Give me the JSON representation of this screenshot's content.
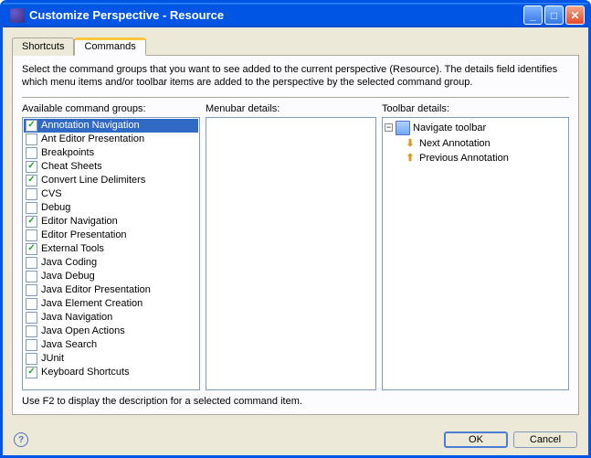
{
  "window": {
    "title": "Customize Perspective - Resource"
  },
  "tabs": {
    "shortcuts": "Shortcuts",
    "commands": "Commands"
  },
  "description": "Select the command groups that you want to see added to the current perspective (Resource).  The details field identifies which menu items and/or toolbar items are added to the perspective by the selected command group.",
  "labels": {
    "available": "Available command groups:",
    "menubar": "Menubar details:",
    "toolbar": "Toolbar details:"
  },
  "commandGroups": [
    {
      "label": "Annotation Navigation",
      "checked": true,
      "selected": true
    },
    {
      "label": "Ant Editor Presentation",
      "checked": false
    },
    {
      "label": "Breakpoints",
      "checked": false
    },
    {
      "label": "Cheat Sheets",
      "checked": true
    },
    {
      "label": "Convert Line Delimiters",
      "checked": true
    },
    {
      "label": "CVS",
      "checked": false
    },
    {
      "label": "Debug",
      "checked": false
    },
    {
      "label": "Editor Navigation",
      "checked": true
    },
    {
      "label": "Editor Presentation",
      "checked": false
    },
    {
      "label": "External Tools",
      "checked": true
    },
    {
      "label": "Java Coding",
      "checked": false
    },
    {
      "label": "Java Debug",
      "checked": false
    },
    {
      "label": "Java Editor Presentation",
      "checked": false
    },
    {
      "label": "Java Element Creation",
      "checked": false
    },
    {
      "label": "Java Navigation",
      "checked": false
    },
    {
      "label": "Java Open Actions",
      "checked": false
    },
    {
      "label": "Java Search",
      "checked": false
    },
    {
      "label": "JUnit",
      "checked": false
    },
    {
      "label": "Keyboard Shortcuts",
      "checked": true
    }
  ],
  "toolbarTree": {
    "root": "Navigate toolbar",
    "children": [
      {
        "label": "Next Annotation",
        "icon": "down"
      },
      {
        "label": "Previous Annotation",
        "icon": "up"
      }
    ]
  },
  "hint": "Use F2 to display the description for a selected command item.",
  "buttons": {
    "ok": "OK",
    "cancel": "Cancel"
  }
}
